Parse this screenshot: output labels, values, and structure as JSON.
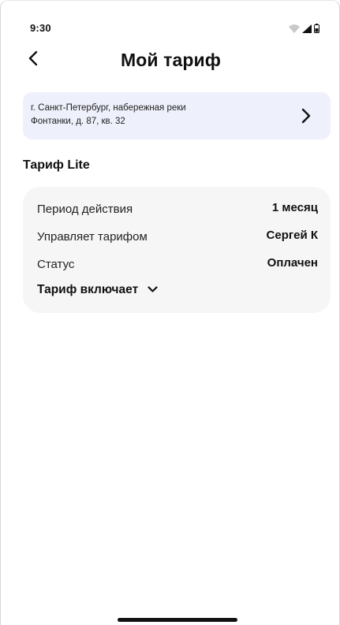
{
  "status_bar": {
    "time": "9:30",
    "icons": [
      "wifi-icon",
      "cellular-signal-icon",
      "battery-icon"
    ]
  },
  "header": {
    "back_icon": "chevron-left-icon",
    "title": "Мой тариф"
  },
  "address": {
    "line1": "г. Санкт-Петербург, набережная реки",
    "line2": "Фонтанки, д. 87, кв. 32",
    "arrow_icon": "chevron-right-icon"
  },
  "tariff": {
    "name": "Тариф Lite",
    "rows": [
      {
        "label": "Период действия",
        "value": "1 месяц"
      },
      {
        "label": "Управляет тарифом",
        "value": "Сергей К"
      },
      {
        "label": "Статус",
        "value": "Оплачен"
      }
    ],
    "includes_label": "Тариф включает",
    "includes_icon": "chevron-down-icon"
  },
  "colors": {
    "address_card_bg": "#eef0fb",
    "info_card_bg": "#f6f6f6",
    "text": "#111111"
  }
}
